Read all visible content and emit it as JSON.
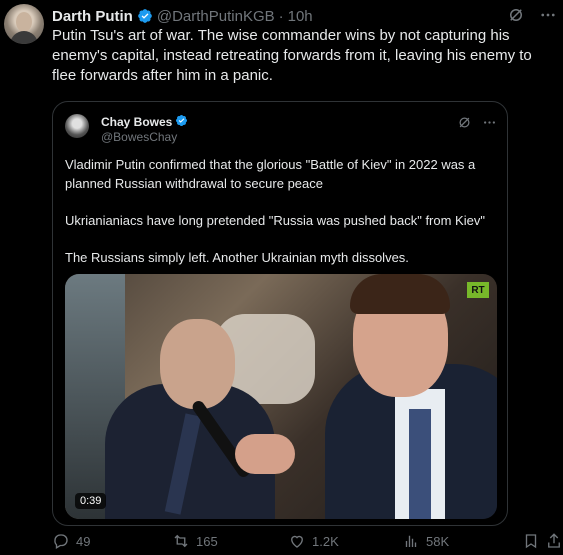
{
  "author": {
    "name": "Darth Putin",
    "handle": "@DarthPutinKGB",
    "separator": "·",
    "time": "10h"
  },
  "tweet": {
    "text": "Putin Tsu's art of war. The wise commander wins by not capturing his enemy's capital, instead retreating forwards from it, leaving his enemy to flee forwards after him in a panic."
  },
  "quote": {
    "name": "Chay Bowes",
    "handle": "@BowesChay",
    "paragraphs": [
      "Vladimir Putin confirmed that the glorious \"Battle of Kiev\" in 2022 was a planned Russian withdrawal to secure peace",
      "Ukrianianiacs have long pretended \"Russia was pushed back\" from Kiev\"",
      "The Russians simply left. Another Ukrainian myth dissolves."
    ],
    "video": {
      "badge": "RT",
      "duration": "0:39"
    }
  },
  "actions": {
    "replies": "49",
    "reposts": "165",
    "likes": "1.2K",
    "views": "58K"
  },
  "colors": {
    "background": "#000000",
    "text": "#e7e9ea",
    "muted": "#71767b",
    "verified": "#1d9bf0",
    "border": "#2f3336"
  }
}
